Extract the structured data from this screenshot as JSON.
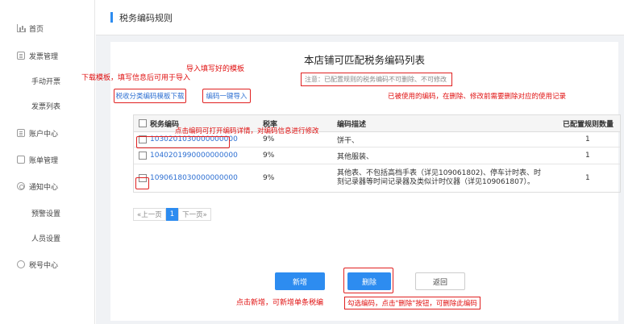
{
  "sidebar": {
    "items": [
      {
        "label": "首页",
        "icon": "home-chart-icon"
      },
      {
        "label": "发票管理",
        "icon": "invoice-icon"
      },
      {
        "label": "手动开票"
      },
      {
        "label": "发票列表"
      },
      {
        "label": "账户中心",
        "icon": "account-icon"
      },
      {
        "label": "账单管理",
        "icon": "bill-icon"
      },
      {
        "label": "通知中心",
        "icon": "gear-icon"
      },
      {
        "label": "预警设置"
      },
      {
        "label": "人员设置"
      },
      {
        "label": "税号中心",
        "icon": "tax-circle-icon"
      }
    ]
  },
  "header": {
    "title": "税务编码规则"
  },
  "main": {
    "list_title": "本店铺可匹配税务编码列表",
    "notice": "注意：已配置规则的税务编码不可删除、不可修改",
    "download_template_button": "税收分类编码模板下载",
    "import_button": "编码一键导入",
    "table": {
      "headers": {
        "code": "税务编码",
        "rate": "税率",
        "desc": "编码描述",
        "count": "已配置规则数量"
      },
      "rows": [
        {
          "code": "1030201030000000000",
          "rate": "9%",
          "desc": "饼干、",
          "count": "1"
        },
        {
          "code": "1040201990000000000",
          "rate": "9%",
          "desc": "其他服装、",
          "count": "1"
        },
        {
          "code": "1090618030000000000",
          "rate": "9%",
          "desc": "其他表、不包括高档手表（详见109061802)、停车计时表、时刻记录器等时间记录器及类似计时仪器（详见109061807）。",
          "count": "1"
        }
      ]
    },
    "pager": {
      "prev": "«上一页",
      "current": "1",
      "next": "下一页»"
    },
    "buttons": {
      "add": "新增",
      "delete": "删除",
      "back": "返回"
    }
  },
  "annotations": {
    "download_hint": "下载模板，填写信息后可用于导入",
    "import_hint": "导入填写好的模板",
    "used_hint": "已被使用的编码，在删除、修改前需要删除对应的使用记录",
    "click_code_hint": "点击编码可打开编码详情，对编码信息进行修改",
    "add_hint": "点击新增，可新增单条税编",
    "delete_hint": "勾选编码，点击\"删除\"按钮，可删除此编码"
  },
  "colors": {
    "accent": "#2d8cf0",
    "annotation": "#e01010"
  }
}
